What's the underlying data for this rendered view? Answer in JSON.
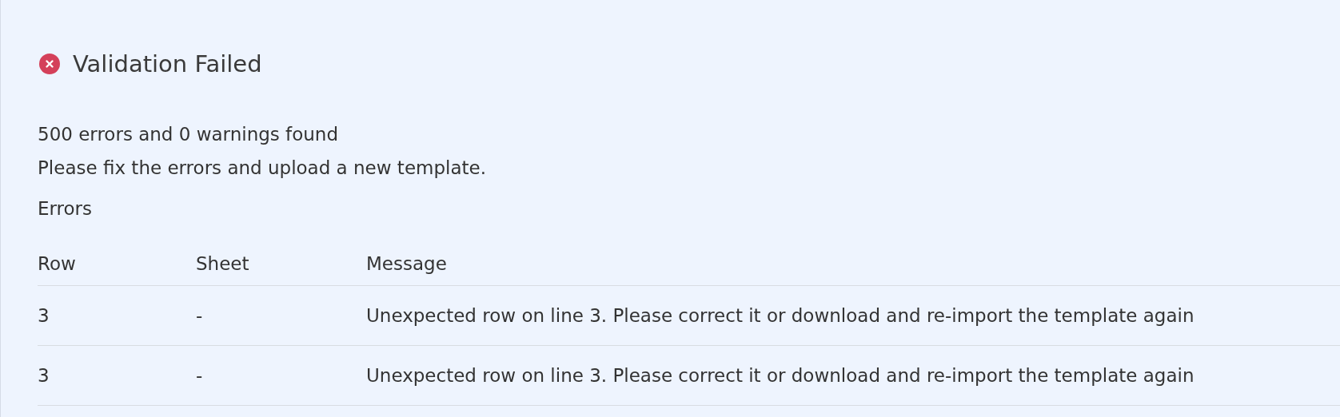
{
  "header": {
    "failed": true,
    "title": "Validation Failed"
  },
  "summary": [
    "500 errors and 0 warnings found",
    "Please fix the errors and upload a new template."
  ],
  "section_title": "Errors",
  "table": {
    "columns": [
      "Row",
      "Sheet",
      "Message"
    ],
    "rows": [
      [
        "3",
        "-",
        "Unexpected row on line 3. Please correct it or download and re-import the template again"
      ],
      [
        "3",
        "-",
        "Unexpected row on line 3. Please correct it or download and re-import the template again"
      ]
    ]
  }
}
